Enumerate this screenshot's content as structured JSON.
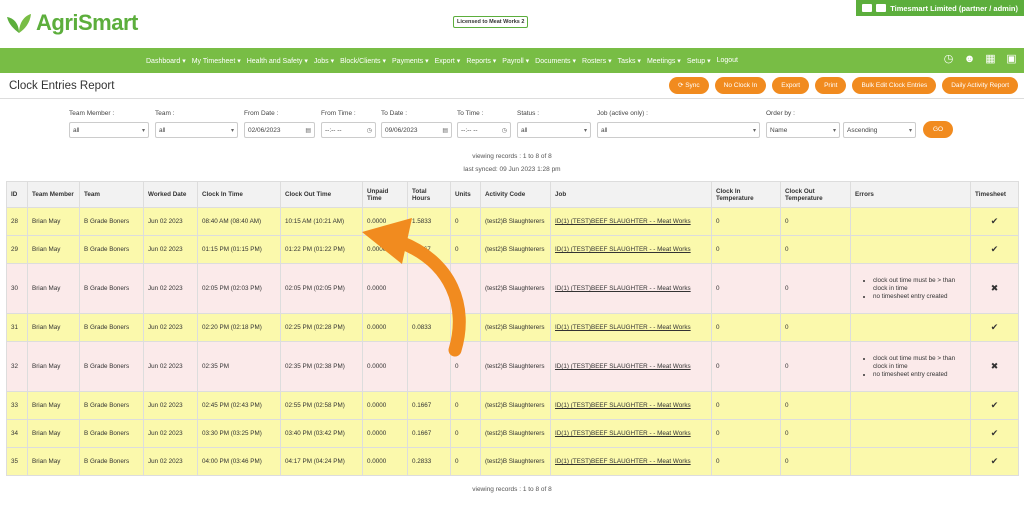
{
  "brand": {
    "name": "AgriSmart",
    "license": "Licensed to Meat Works 2",
    "account": "Timesmart Limited (partner / admin)"
  },
  "nav": {
    "items": [
      "Dashboard ▾",
      "My Timesheet ▾",
      "Health and Safety ▾",
      "Jobs ▾",
      "Block/Clients ▾",
      "Payments ▾",
      "Export ▾",
      "Reports ▾",
      "Payroll ▾",
      "Documents ▾",
      "Rosters ▾",
      "Tasks ▾",
      "Meetings ▾",
      "Setup ▾",
      "Logout"
    ]
  },
  "page": {
    "title": "Clock Entries Report"
  },
  "buttons": {
    "sync": "Sync",
    "noclock": "No Clock In",
    "export": "Export",
    "print": "Print",
    "bulk": "Bulk Edit Clock Entries",
    "daily": "Daily Activity Report",
    "go": "GO"
  },
  "filters": {
    "team_member": {
      "label": "Team Member :",
      "value": "all"
    },
    "team": {
      "label": "Team :",
      "value": "all"
    },
    "from_date": {
      "label": "From Date :",
      "value": "02/06/2023"
    },
    "from_time": {
      "label": "From Time :",
      "value": "--:-- --"
    },
    "to_date": {
      "label": "To Date :",
      "value": "09/06/2023"
    },
    "to_time": {
      "label": "To Time :",
      "value": "--:-- --"
    },
    "status": {
      "label": "Status :",
      "value": "all"
    },
    "job": {
      "label": "Job (active only) :",
      "value": "all"
    },
    "order_by": {
      "label": "Order by :",
      "value": "Name"
    },
    "order_dir": {
      "value": "Ascending"
    }
  },
  "info": {
    "records_top": "viewing records : 1 to 8 of 8",
    "last_synced": "last synced: 09 Jun 2023 1:28 pm",
    "records_bottom": "viewing records : 1 to 8 of 8"
  },
  "table": {
    "headers": [
      "ID",
      "Team Member",
      "Team",
      "Worked Date",
      "Clock In Time",
      "Clock Out Time",
      "Unpaid Time",
      "Total Hours",
      "Units",
      "Activity Code",
      "Job",
      "Clock In Temperature",
      "Clock Out Temperature",
      "Errors",
      "Timesheet"
    ],
    "rows": [
      {
        "id": "28",
        "member": "Brian May",
        "team": "B Grade Boners",
        "date": "Jun 02 2023",
        "in": "08:40 AM (08:40 AM)",
        "out": "10:15 AM (10:21 AM)",
        "unpaid": "0.0000",
        "total": "1.5833",
        "units": "0",
        "code": "(test2)B Slaughterers",
        "job": "ID(1) (TEST)BEEF SLAUGHTER - - Meat Works",
        "tin": "0",
        "tout": "0",
        "errors": [],
        "ts": "✔",
        "status": "ok"
      },
      {
        "id": "29",
        "member": "Brian May",
        "team": "B Grade Boners",
        "date": "Jun 02 2023",
        "in": "01:15 PM (01:15 PM)",
        "out": "01:22 PM (01:22 PM)",
        "unpaid": "0.0000",
        "total": "0.1167",
        "units": "0",
        "code": "(test2)B Slaughterers",
        "job": "ID(1) (TEST)BEEF SLAUGHTER - - Meat Works",
        "tin": "0",
        "tout": "0",
        "errors": [],
        "ts": "✔",
        "status": "ok"
      },
      {
        "id": "30",
        "member": "Brian May",
        "team": "B Grade Boners",
        "date": "Jun 02 2023",
        "in": "02:05 PM (02:03 PM)",
        "out": "02:05 PM (02:05 PM)",
        "unpaid": "0.0000",
        "total": "",
        "units": "0",
        "code": "(test2)B Slaughterers",
        "job": "ID(1) (TEST)BEEF SLAUGHTER - - Meat Works",
        "tin": "0",
        "tout": "0",
        "errors": [
          "clock out time must be > than clock in time",
          "no timesheet entry created"
        ],
        "ts": "✖",
        "status": "err"
      },
      {
        "id": "31",
        "member": "Brian May",
        "team": "B Grade Boners",
        "date": "Jun 02 2023",
        "in": "02:20 PM (02:18 PM)",
        "out": "02:25 PM (02:28 PM)",
        "unpaid": "0.0000",
        "total": "0.0833",
        "units": "0",
        "code": "(test2)B Slaughterers",
        "job": "ID(1) (TEST)BEEF SLAUGHTER - - Meat Works",
        "tin": "0",
        "tout": "0",
        "errors": [],
        "ts": "✔",
        "status": "ok"
      },
      {
        "id": "32",
        "member": "Brian May",
        "team": "B Grade Boners",
        "date": "Jun 02 2023",
        "in": "02:35 PM",
        "out": "02:35 PM (02:38 PM)",
        "unpaid": "0.0000",
        "total": "",
        "units": "0",
        "code": "(test2)B Slaughterers",
        "job": "ID(1) (TEST)BEEF SLAUGHTER - - Meat Works",
        "tin": "0",
        "tout": "0",
        "errors": [
          "clock out time must be > than clock in time",
          "no timesheet entry created"
        ],
        "ts": "✖",
        "status": "err"
      },
      {
        "id": "33",
        "member": "Brian May",
        "team": "B Grade Boners",
        "date": "Jun 02 2023",
        "in": "02:45 PM (02:43 PM)",
        "out": "02:55 PM (02:58 PM)",
        "unpaid": "0.0000",
        "total": "0.1667",
        "units": "0",
        "code": "(test2)B Slaughterers",
        "job": "ID(1) (TEST)BEEF SLAUGHTER - - Meat Works",
        "tin": "0",
        "tout": "0",
        "errors": [],
        "ts": "✔",
        "status": "ok"
      },
      {
        "id": "34",
        "member": "Brian May",
        "team": "B Grade Boners",
        "date": "Jun 02 2023",
        "in": "03:30 PM (03:25 PM)",
        "out": "03:40 PM (03:42 PM)",
        "unpaid": "0.0000",
        "total": "0.1667",
        "units": "0",
        "code": "(test2)B Slaughterers",
        "job": "ID(1) (TEST)BEEF SLAUGHTER - - Meat Works",
        "tin": "0",
        "tout": "0",
        "errors": [],
        "ts": "✔",
        "status": "ok"
      },
      {
        "id": "35",
        "member": "Brian May",
        "team": "B Grade Boners",
        "date": "Jun 02 2023",
        "in": "04:00 PM (03:46 PM)",
        "out": "04:17 PM (04:24 PM)",
        "unpaid": "0.0000",
        "total": "0.2833",
        "units": "0",
        "code": "(test2)B Slaughterers",
        "job": "ID(1) (TEST)BEEF SLAUGHTER - - Meat Works",
        "tin": "0",
        "tout": "0",
        "errors": [],
        "ts": "✔",
        "status": "ok"
      }
    ]
  },
  "colors": {
    "brand_green": "#78bd45",
    "accent_orange": "#f18b1f",
    "row_ok": "#fbf9ac",
    "row_error": "#fbeaea"
  }
}
